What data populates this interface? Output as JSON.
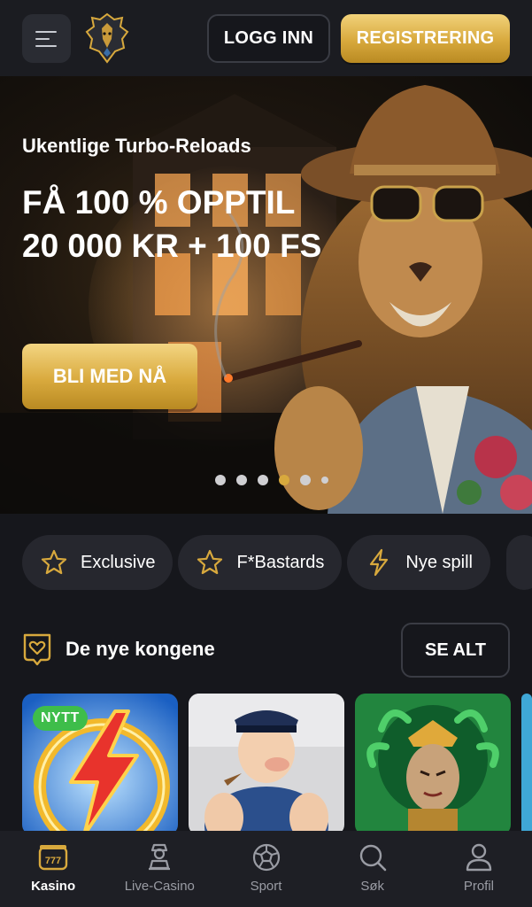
{
  "header": {
    "menu_icon": "hamburger-menu-icon",
    "logo": "lion-logo",
    "login_label": "LOGG INN",
    "register_label": "REGISTRERING"
  },
  "hero": {
    "subtitle": "Ukentlige Turbo-Reloads",
    "title": "FÅ 100 % OPPTIL 20 000 KR + 100 FS",
    "cta_label": "BLI MED NÅ",
    "slide_count": 6,
    "active_slide": 4
  },
  "categories": [
    {
      "label": "Exclusive",
      "icon": "star-icon"
    },
    {
      "label": "F*Bastards",
      "icon": "star-icon"
    },
    {
      "label": "Nye spill",
      "icon": "lightning-icon"
    }
  ],
  "section": {
    "icon": "heart-crown-icon",
    "title": "De nye kongene",
    "see_all_label": "SE ALT"
  },
  "games": [
    {
      "badge": "NYTT",
      "theme": "lightning-game"
    },
    {
      "badge": "",
      "theme": "sailor-game"
    },
    {
      "badge": "",
      "theme": "medusa-game"
    }
  ],
  "bottom_nav": [
    {
      "label": "Kasino",
      "icon": "slot-machine-icon",
      "active": true
    },
    {
      "label": "Live-Casino",
      "icon": "dealer-icon",
      "active": false
    },
    {
      "label": "Sport",
      "icon": "soccer-ball-icon",
      "active": false
    },
    {
      "label": "Søk",
      "icon": "search-icon",
      "active": false
    },
    {
      "label": "Profil",
      "icon": "user-icon",
      "active": false
    }
  ],
  "colors": {
    "background": "#16171c",
    "gold": "#d8a93d",
    "chip_bg": "#26272e",
    "badge_green": "#3ebd4a"
  }
}
